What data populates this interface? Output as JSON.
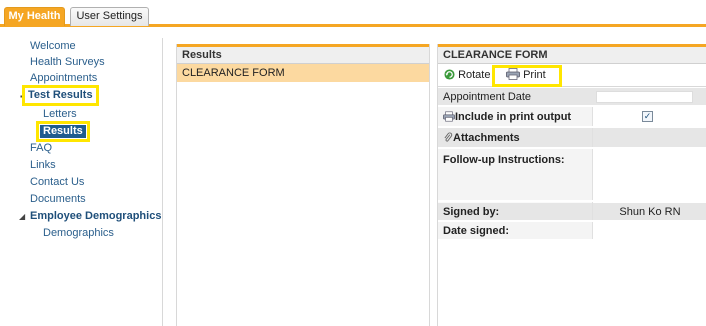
{
  "tabs": {
    "my_health": "My Health",
    "user_settings": "User Settings"
  },
  "nav": {
    "welcome": "Welcome",
    "health_surveys": "Health Surveys",
    "appointments": "Appointments",
    "test_results": "Test Results",
    "letters": "Letters",
    "results": "Results",
    "faq": "FAQ",
    "links": "Links",
    "contact_us": "Contact Us",
    "documents": "Documents",
    "employee_demographics": "Employee Demographics",
    "demographics": "Demographics"
  },
  "results_panel": {
    "header": "Results",
    "rows": [
      "CLEARANCE FORM"
    ]
  },
  "form": {
    "header": "CLEARANCE FORM",
    "rotate": "Rotate",
    "print": "Print",
    "appointment_date_label": "Appointment Date",
    "appointment_date_value": "",
    "include_label": "Include in print output",
    "include_checked": "✓",
    "attachments_label": "Attachments",
    "followup_label": "Follow-up Instructions:",
    "signed_by_label": "Signed by:",
    "signed_by_value": "Shun Ko RN",
    "date_signed_label": "Date signed:"
  },
  "colors": {
    "accent": "#f5a623",
    "highlight": "#ffe600",
    "nav_link": "#2b5f8c",
    "selected_bg": "#1f5c8f"
  }
}
